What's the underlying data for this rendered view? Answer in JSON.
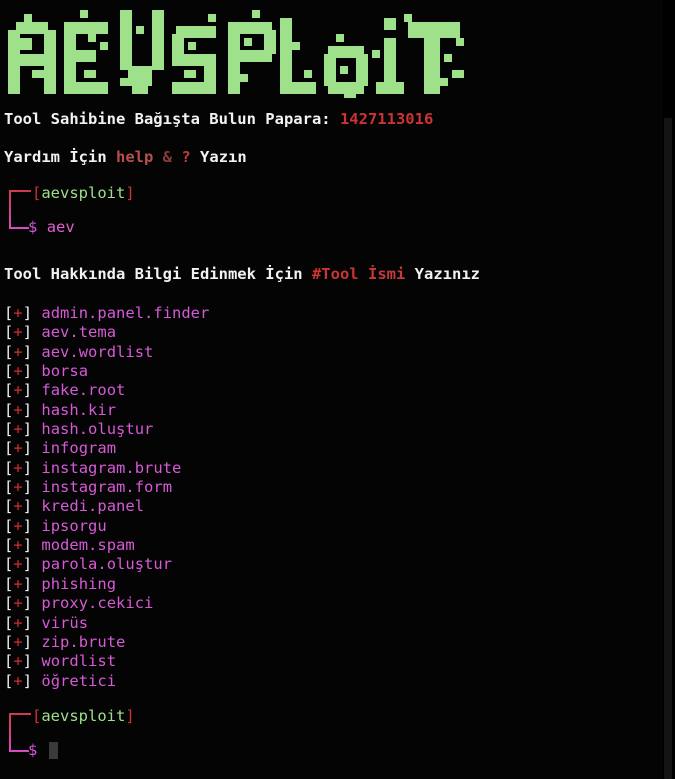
{
  "terminal": {
    "title": "aevsploit",
    "background": "#040404",
    "foreground": "#f2f2f2"
  },
  "banner": {
    "text": "AEVSPLOIT",
    "style": "pixel-block-ascii-art",
    "color": "#9fe08a"
  },
  "donation_line": {
    "label": "Tool Sahibine Bağışta Bulun Papara:",
    "value": "1427113016",
    "value_color": "#cc3333"
  },
  "help_line": {
    "prefix": "Yardım İçin",
    "command": "help",
    "separator": "&",
    "alt_command": "?",
    "suffix": "Yazın",
    "command_color": "#b5504f"
  },
  "prompt_first": {
    "bracket_open": "[",
    "host": "aevsploit",
    "bracket_close": "]",
    "symbol": "$",
    "command": "aev",
    "host_color": "#9fe08a",
    "bracket_color": "#cc3333",
    "symbol_color": "#d955d9",
    "command_color": "#d955d9"
  },
  "info_line": {
    "prefix": "Tool Hakkında Bilgi Edinmek İçin",
    "hashtag": "#Tool",
    "word": "İsmi",
    "suffix": "Yazınız",
    "accent_color": "#cc3333"
  },
  "tool_list": {
    "marker_open": "[",
    "marker_symbol": "+",
    "marker_close": "]",
    "marker_color": "#cc2f2f",
    "item_color": "#d65ad6",
    "items": [
      "admin.panel.finder",
      "aev.tema",
      "aev.wordlist",
      "borsa",
      "fake.root",
      "hash.kir",
      "hash.oluştur",
      "infogram",
      "instagram.brute",
      "instagram.form",
      "kredi.panel",
      "ipsorgu",
      "modem.spam",
      "parola.oluştur",
      "phishing",
      "proxy.cekici",
      "virüs",
      "wordlist",
      "zip.brute",
      "wordlist",
      "öğretici"
    ],
    "visible_items": [
      "admin.panel.finder",
      "aev.tema",
      "aev.wordlist",
      "borsa",
      "fake.root",
      "hash.kir",
      "hash.oluştur",
      "infogram",
      "instagram.brute",
      "instagram.form",
      "kredi.panel",
      "ipsorgu",
      "modem.spam",
      "parola.oluştur",
      "phishing",
      "proxy.cekici",
      "virüs",
      "zip.brute",
      "wordlist",
      "öğretici"
    ],
    "count": 20
  },
  "prompt_second": {
    "bracket_open": "[",
    "host": "aevsploit",
    "bracket_close": "]",
    "symbol": "$",
    "input_value": "",
    "cursor": "block"
  },
  "scrollbar": {
    "orientation": "vertical",
    "thumb_color": "#141414"
  }
}
